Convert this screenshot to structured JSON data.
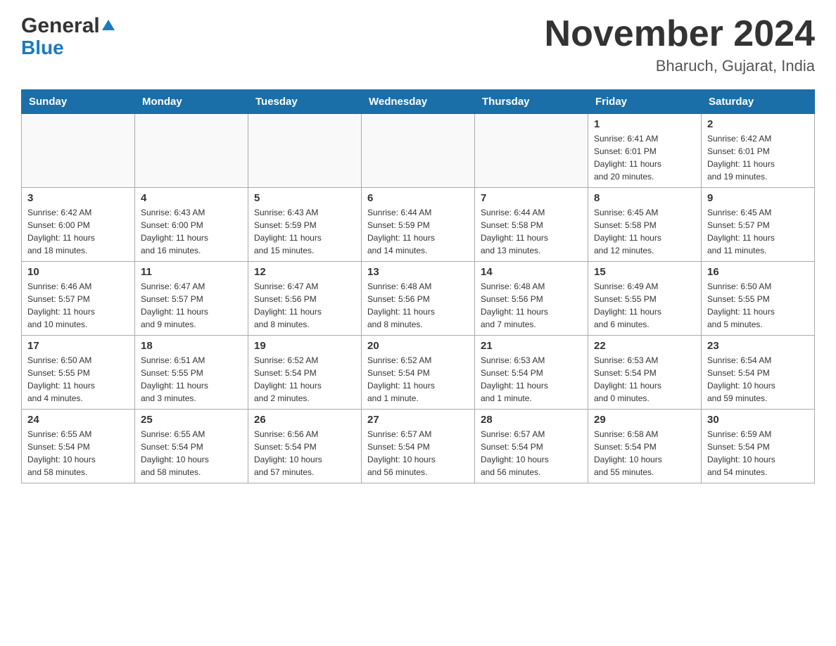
{
  "header": {
    "logo_general": "General",
    "logo_blue": "Blue",
    "month_year": "November 2024",
    "location": "Bharuch, Gujarat, India"
  },
  "days_of_week": [
    "Sunday",
    "Monday",
    "Tuesday",
    "Wednesday",
    "Thursday",
    "Friday",
    "Saturday"
  ],
  "weeks": [
    [
      {
        "day": "",
        "info": ""
      },
      {
        "day": "",
        "info": ""
      },
      {
        "day": "",
        "info": ""
      },
      {
        "day": "",
        "info": ""
      },
      {
        "day": "",
        "info": ""
      },
      {
        "day": "1",
        "info": "Sunrise: 6:41 AM\nSunset: 6:01 PM\nDaylight: 11 hours\nand 20 minutes."
      },
      {
        "day": "2",
        "info": "Sunrise: 6:42 AM\nSunset: 6:01 PM\nDaylight: 11 hours\nand 19 minutes."
      }
    ],
    [
      {
        "day": "3",
        "info": "Sunrise: 6:42 AM\nSunset: 6:00 PM\nDaylight: 11 hours\nand 18 minutes."
      },
      {
        "day": "4",
        "info": "Sunrise: 6:43 AM\nSunset: 6:00 PM\nDaylight: 11 hours\nand 16 minutes."
      },
      {
        "day": "5",
        "info": "Sunrise: 6:43 AM\nSunset: 5:59 PM\nDaylight: 11 hours\nand 15 minutes."
      },
      {
        "day": "6",
        "info": "Sunrise: 6:44 AM\nSunset: 5:59 PM\nDaylight: 11 hours\nand 14 minutes."
      },
      {
        "day": "7",
        "info": "Sunrise: 6:44 AM\nSunset: 5:58 PM\nDaylight: 11 hours\nand 13 minutes."
      },
      {
        "day": "8",
        "info": "Sunrise: 6:45 AM\nSunset: 5:58 PM\nDaylight: 11 hours\nand 12 minutes."
      },
      {
        "day": "9",
        "info": "Sunrise: 6:45 AM\nSunset: 5:57 PM\nDaylight: 11 hours\nand 11 minutes."
      }
    ],
    [
      {
        "day": "10",
        "info": "Sunrise: 6:46 AM\nSunset: 5:57 PM\nDaylight: 11 hours\nand 10 minutes."
      },
      {
        "day": "11",
        "info": "Sunrise: 6:47 AM\nSunset: 5:57 PM\nDaylight: 11 hours\nand 9 minutes."
      },
      {
        "day": "12",
        "info": "Sunrise: 6:47 AM\nSunset: 5:56 PM\nDaylight: 11 hours\nand 8 minutes."
      },
      {
        "day": "13",
        "info": "Sunrise: 6:48 AM\nSunset: 5:56 PM\nDaylight: 11 hours\nand 8 minutes."
      },
      {
        "day": "14",
        "info": "Sunrise: 6:48 AM\nSunset: 5:56 PM\nDaylight: 11 hours\nand 7 minutes."
      },
      {
        "day": "15",
        "info": "Sunrise: 6:49 AM\nSunset: 5:55 PM\nDaylight: 11 hours\nand 6 minutes."
      },
      {
        "day": "16",
        "info": "Sunrise: 6:50 AM\nSunset: 5:55 PM\nDaylight: 11 hours\nand 5 minutes."
      }
    ],
    [
      {
        "day": "17",
        "info": "Sunrise: 6:50 AM\nSunset: 5:55 PM\nDaylight: 11 hours\nand 4 minutes."
      },
      {
        "day": "18",
        "info": "Sunrise: 6:51 AM\nSunset: 5:55 PM\nDaylight: 11 hours\nand 3 minutes."
      },
      {
        "day": "19",
        "info": "Sunrise: 6:52 AM\nSunset: 5:54 PM\nDaylight: 11 hours\nand 2 minutes."
      },
      {
        "day": "20",
        "info": "Sunrise: 6:52 AM\nSunset: 5:54 PM\nDaylight: 11 hours\nand 1 minute."
      },
      {
        "day": "21",
        "info": "Sunrise: 6:53 AM\nSunset: 5:54 PM\nDaylight: 11 hours\nand 1 minute."
      },
      {
        "day": "22",
        "info": "Sunrise: 6:53 AM\nSunset: 5:54 PM\nDaylight: 11 hours\nand 0 minutes."
      },
      {
        "day": "23",
        "info": "Sunrise: 6:54 AM\nSunset: 5:54 PM\nDaylight: 10 hours\nand 59 minutes."
      }
    ],
    [
      {
        "day": "24",
        "info": "Sunrise: 6:55 AM\nSunset: 5:54 PM\nDaylight: 10 hours\nand 58 minutes."
      },
      {
        "day": "25",
        "info": "Sunrise: 6:55 AM\nSunset: 5:54 PM\nDaylight: 10 hours\nand 58 minutes."
      },
      {
        "day": "26",
        "info": "Sunrise: 6:56 AM\nSunset: 5:54 PM\nDaylight: 10 hours\nand 57 minutes."
      },
      {
        "day": "27",
        "info": "Sunrise: 6:57 AM\nSunset: 5:54 PM\nDaylight: 10 hours\nand 56 minutes."
      },
      {
        "day": "28",
        "info": "Sunrise: 6:57 AM\nSunset: 5:54 PM\nDaylight: 10 hours\nand 56 minutes."
      },
      {
        "day": "29",
        "info": "Sunrise: 6:58 AM\nSunset: 5:54 PM\nDaylight: 10 hours\nand 55 minutes."
      },
      {
        "day": "30",
        "info": "Sunrise: 6:59 AM\nSunset: 5:54 PM\nDaylight: 10 hours\nand 54 minutes."
      }
    ]
  ]
}
